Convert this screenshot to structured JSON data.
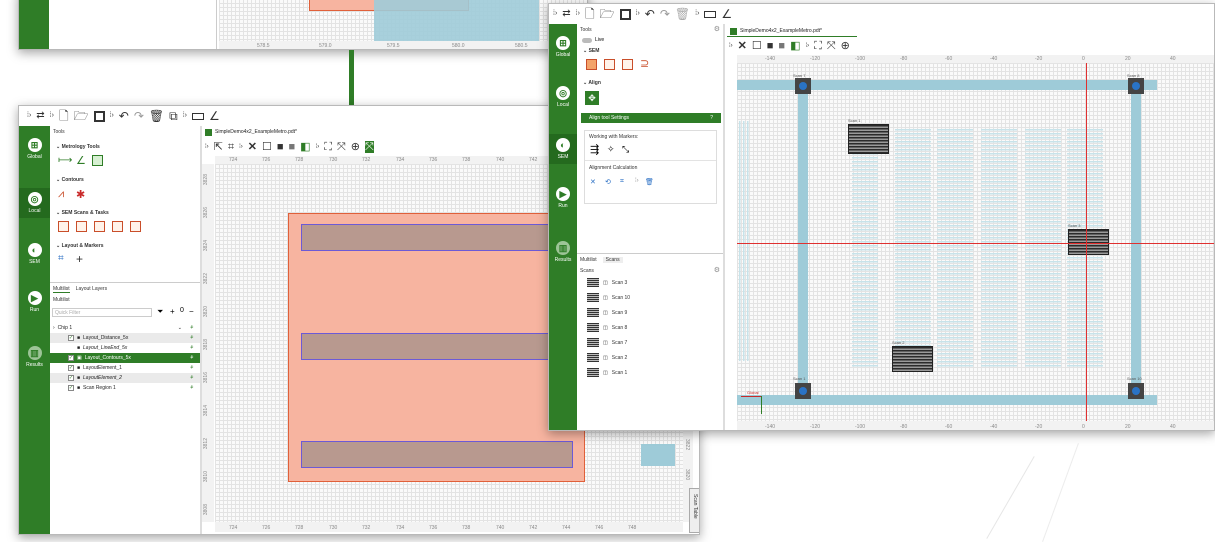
{
  "back_window": {
    "ruler_ticks": [
      "578.5",
      "579.0",
      "579.5",
      "580.0",
      "580.5"
    ]
  },
  "left_window": {
    "toolbar_icons": [
      "chevron-right",
      "swap",
      "chevron-right",
      "new-file",
      "open-folder",
      "save",
      "chevron-right",
      "undo",
      "redo",
      "delete",
      "copy",
      "chevron-right",
      "rectangle",
      "angle"
    ],
    "rail": [
      {
        "label": "Global",
        "icon": "grid-icon"
      },
      {
        "label": "Local",
        "icon": "target-icon"
      },
      {
        "label": "SEM",
        "icon": "sem-icon"
      },
      {
        "label": "Run",
        "icon": "play-icon"
      },
      {
        "label": "Results",
        "icon": "chart-icon"
      }
    ],
    "tools_label": "Tools",
    "sections": {
      "metrology": "Metrology Tools",
      "contours": "Contours",
      "sem_scans": "SEM Scans & Tasks",
      "layout_markers": "Layout & Markers"
    },
    "tabs": {
      "multilist": "Multilist",
      "layout_layers": "Layout Layers"
    },
    "multilist_label": "Multilist",
    "quick_filter_placeholder": "Quick Filter",
    "tree": {
      "root": "Chip 1",
      "items": [
        {
          "label": "Layout_Distance_5x",
          "italic": false
        },
        {
          "label": "Layout_LineEnd_5x",
          "italic": true
        },
        {
          "label": "Layout_Contours_5x",
          "italic": false
        },
        {
          "label": "LayoutElement_1",
          "italic": false
        },
        {
          "label": "LayoutElement_2",
          "italic": true
        },
        {
          "label": "Scan Region 1",
          "italic": false
        }
      ]
    },
    "doc_tab": "SimpleDemo4x2_ExampleMetro.pdt*",
    "top_ruler": [
      "724",
      "726",
      "728",
      "730",
      "732",
      "734",
      "736",
      "738",
      "740",
      "742",
      "744",
      "746"
    ],
    "bottom_ruler": [
      "724",
      "726",
      "728",
      "730",
      "732",
      "734",
      "736",
      "738",
      "740",
      "742",
      "744",
      "746",
      "748"
    ],
    "left_ruler": [
      "3828",
      "3826",
      "3824",
      "3822",
      "3820",
      "3818",
      "3816",
      "3814",
      "3812",
      "3810",
      "3808"
    ],
    "right_ruler": [
      "3822",
      "3820"
    ],
    "scan_table_tab": "Scan Table",
    "colors": {
      "rail": "#2f7d27",
      "layout_fill": "#f7b4a0",
      "layout_border": "#e0603a",
      "bar_fill": "#b8998f",
      "bar_border": "#6c5ad6"
    }
  },
  "right_window": {
    "toolbar_icons": [
      "chevron-right",
      "swap",
      "chevron-right",
      "new-file",
      "open-folder",
      "save",
      "chevron-right",
      "undo",
      "redo",
      "delete",
      "chevron-right",
      "rectangle",
      "angle"
    ],
    "rail": [
      {
        "label": "Global",
        "icon": "grid-icon"
      },
      {
        "label": "Local",
        "icon": "target-icon"
      },
      {
        "label": "SEM",
        "icon": "sem-icon"
      },
      {
        "label": "Run",
        "icon": "play-icon"
      },
      {
        "label": "Results",
        "icon": "chart-icon"
      }
    ],
    "tools_label": "Tools",
    "live_label": "Live",
    "sem_section": "SEM",
    "align_section": "Align",
    "align_settings_title": "Align tool Settings",
    "help_mark": "?",
    "working_with_markers": "Working with Markers:",
    "alignment_calculation": "Alignment Calculation",
    "tabs": {
      "multilist": "Multilist",
      "scans": "Scans"
    },
    "scans_label": "Scans",
    "scans": [
      "Scan 3",
      "Scan 10",
      "Scan 9",
      "Scan 8",
      "Scan 7",
      "Scan 2",
      "Scan 1"
    ],
    "doc_tab": "SimpleDemo4x2_ExampleMetro.pdt*",
    "top_ruler": [
      "-140",
      "-120",
      "-100",
      "-80",
      "-60",
      "-40",
      "-20",
      "0",
      "20",
      "40"
    ],
    "bottom_ruler": [
      "-140",
      "-120",
      "-100",
      "-80",
      "-60",
      "-40",
      "-20",
      "0",
      "20",
      "40"
    ],
    "scan_labels": {
      "tl": "Scan 7",
      "tr": "Scan 8",
      "bl": "Scan 1",
      "br": "Scan 10",
      "mid": "Scan 3",
      "top": "Scan 1",
      "bot": "Scan 2"
    },
    "origin_label": "Global",
    "colors": {
      "strip": "#9ecbd8",
      "crosshair": "#e03030",
      "marker": "#444444",
      "marker_center": "#2a73c5"
    }
  }
}
